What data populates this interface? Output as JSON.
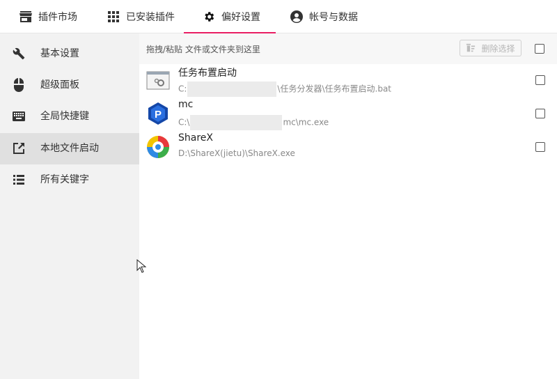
{
  "tabs": [
    {
      "label": "插件市场",
      "icon": "store-icon"
    },
    {
      "label": "已安装插件",
      "icon": "apps-grid-icon"
    },
    {
      "label": "偏好设置",
      "icon": "gear-icon",
      "active": true
    },
    {
      "label": "帐号与数据",
      "icon": "account-circle-icon"
    }
  ],
  "sidebar": {
    "items": [
      {
        "label": "基本设置",
        "icon": "wrench-icon"
      },
      {
        "label": "超级面板",
        "icon": "mouse-icon"
      },
      {
        "label": "全局快捷键",
        "icon": "keyboard-icon"
      },
      {
        "label": "本地文件启动",
        "icon": "open-external-icon",
        "active": true
      },
      {
        "label": "所有关键字",
        "icon": "list-icon"
      }
    ]
  },
  "toolbar": {
    "hint": "拖拽/粘贴 文件或文件夹到这里",
    "delete_label": "删除选择"
  },
  "files": [
    {
      "name": "任务布置启动",
      "path_start": "C:",
      "path_end": "\\任务分发器\\任务布置启动.bat",
      "icon": "batch-file-icon"
    },
    {
      "name": "mc",
      "path_start": "C:\\",
      "path_end": "mc\\mc.exe",
      "icon": "mc-app-icon"
    },
    {
      "name": "ShareX",
      "path_start": "D:\\ShareX(jietu)\\ShareX.exe",
      "path_end": "",
      "icon": "sharex-icon"
    }
  ],
  "colors": {
    "accent": "#e91e63",
    "sidebar_bg": "#f2f2f2",
    "sidebar_active": "#e0e0e0"
  }
}
